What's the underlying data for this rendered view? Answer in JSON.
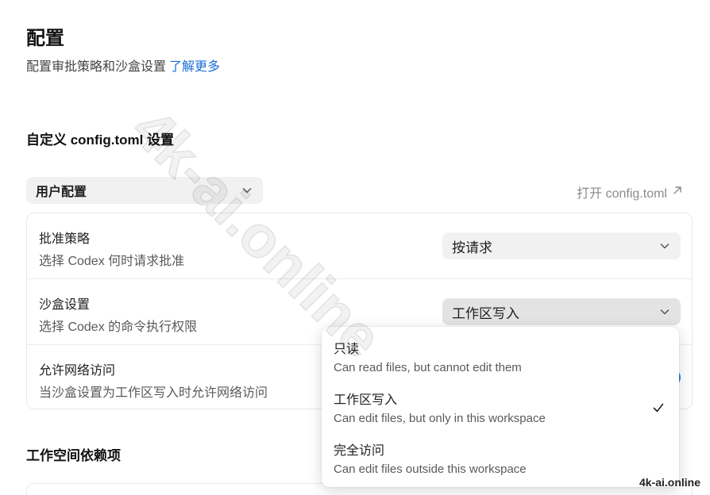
{
  "header": {
    "title": "配置",
    "subtitle": "配置审批策略和沙盒设置",
    "learn_more": "了解更多"
  },
  "custom_section": {
    "title": "自定义 config.toml 设置",
    "profile_select": "用户配置",
    "open_config": "打开 config.toml"
  },
  "settings": {
    "approval": {
      "title": "批准策略",
      "description": "选择 Codex 何时请求批准",
      "value": "按请求"
    },
    "sandbox": {
      "title": "沙盒设置",
      "description": "选择 Codex 的命令执行权限",
      "value": "工作区写入"
    },
    "network": {
      "title": "允许网络访问",
      "description": "当沙盒设置为工作区写入时允许网络访问",
      "enabled": true
    }
  },
  "dropdown": {
    "options": [
      {
        "title": "只读",
        "description": "Can read files, but cannot edit them",
        "selected": false
      },
      {
        "title": "工作区写入",
        "description": "Can edit files, but only in this workspace",
        "selected": true
      },
      {
        "title": "完全访问",
        "description": "Can edit files outside this workspace",
        "selected": false
      }
    ]
  },
  "workspace_section": {
    "title": "工作空间依赖项"
  },
  "watermark": {
    "diagonal": "4k-ai.online",
    "corner": "4k-ai.online"
  },
  "colors": {
    "accent": "#1a6fd8",
    "toggle_on": "#2f7bf0",
    "select_bg": "#f1f1f1"
  },
  "icons": {
    "chevron": "chevron-down-icon",
    "external": "arrow-up-right-icon",
    "check": "check-icon"
  }
}
